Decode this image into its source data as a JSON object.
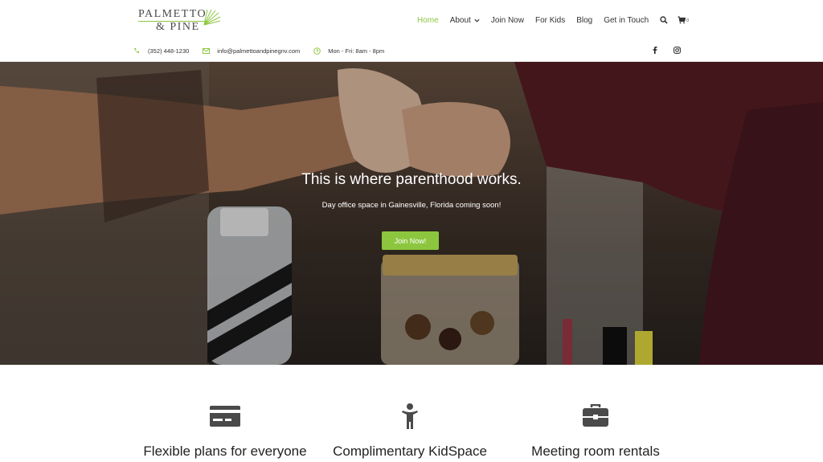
{
  "brand": {
    "line1": "PALMETTO",
    "line2": "& PINE",
    "accent_color": "#8cc63f"
  },
  "nav": {
    "items": [
      {
        "label": "Home",
        "active": true
      },
      {
        "label": "About",
        "has_dropdown": true
      },
      {
        "label": "Join Now"
      },
      {
        "label": "For Kids"
      },
      {
        "label": "Blog"
      },
      {
        "label": "Get in Touch"
      }
    ],
    "search_icon": "search-icon",
    "cart_icon": "cart-icon",
    "cart_count": "0"
  },
  "topbar": {
    "phone": "(352) 448-1230",
    "email": "info@palmettoandpinegnv.com",
    "hours": "Mon - Fri: 8am - 8pm",
    "social": [
      "facebook-icon",
      "instagram-icon"
    ]
  },
  "hero": {
    "title": "This is where parenthood works.",
    "subtitle": "Day office space in Gainesville, Florida coming soon!",
    "cta_label": "Join Now!"
  },
  "features": [
    {
      "title": "Flexible plans for everyone",
      "icon": "credit-card-icon"
    },
    {
      "title": "Complimentary KidSpace",
      "icon": "child-icon"
    },
    {
      "title": "Meeting room rentals",
      "icon": "briefcase-icon"
    }
  ]
}
